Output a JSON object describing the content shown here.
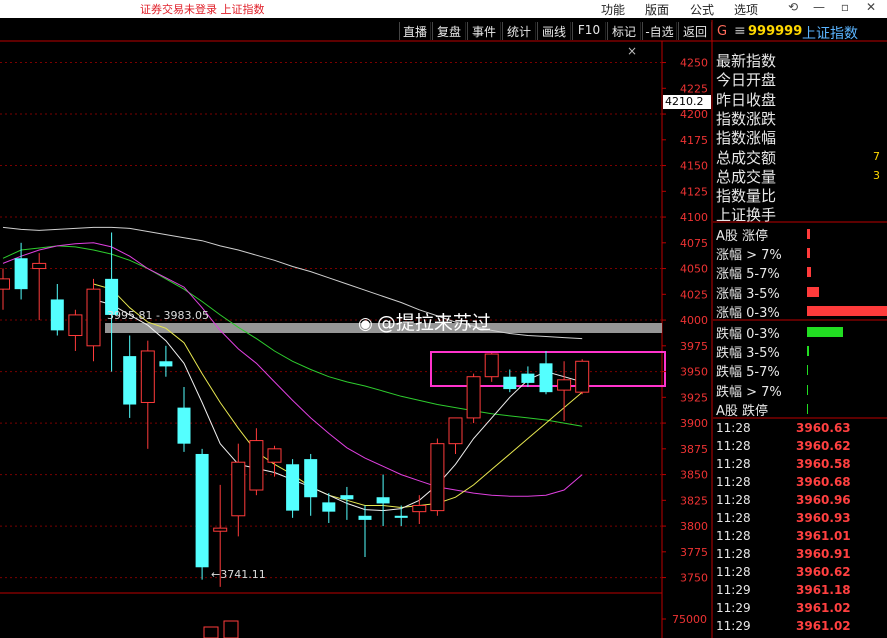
{
  "topbar": {
    "status": "证券交易未登录  上证指数",
    "menus": [
      "功能",
      "版面",
      "公式",
      "选项"
    ],
    "controls": [
      "⟲",
      "—",
      "▫",
      "✕"
    ]
  },
  "toolbar": {
    "buttons": [
      "直播",
      "复盘",
      "事件",
      "统计",
      "画线",
      "F10",
      "标记",
      "-自选",
      "返回"
    ],
    "close": "×"
  },
  "panel": {
    "g": "G",
    "menu_icon": "≡",
    "code": "999999",
    "name": "上证指数",
    "info_labels": [
      "最新指数",
      "今日开盘",
      "昨日收盘",
      "指数涨跌",
      "指数涨幅",
      "总成交额",
      "总成交量",
      "指数量比",
      "上证换手"
    ],
    "info_values": {
      "amount": "7",
      "volume": "3"
    },
    "dist_labels": [
      "A股 涨停",
      "涨幅 > 7%",
      "涨幅 5-7%",
      "涨幅 3-5%",
      "涨幅 0-3%",
      "跌幅 0-3%",
      "跌幅 3-5%",
      "跌幅 5-7%",
      "跌幅 > 7%",
      "A股 跌停"
    ],
    "ticks": [
      {
        "time": "11:28",
        "price": "3960.63"
      },
      {
        "time": "11:28",
        "price": "3960.62"
      },
      {
        "time": "11:28",
        "price": "3960.58"
      },
      {
        "time": "11:28",
        "price": "3960.68"
      },
      {
        "time": "11:28",
        "price": "3960.96"
      },
      {
        "time": "11:28",
        "price": "3960.93"
      },
      {
        "time": "11:28",
        "price": "3961.01"
      },
      {
        "time": "11:28",
        "price": "3960.91"
      },
      {
        "time": "11:28",
        "price": "3960.62"
      },
      {
        "time": "11:29",
        "price": "3961.18"
      },
      {
        "time": "11:29",
        "price": "3961.02"
      },
      {
        "time": "11:29",
        "price": "3961.02"
      }
    ]
  },
  "chart_data": {
    "type": "candlestick",
    "y_ticks": [
      4250,
      4225,
      4200,
      4175,
      4150,
      4125,
      4100,
      4075,
      4050,
      4025,
      4000,
      3975,
      3950,
      3925,
      3900,
      3875,
      3850,
      3825,
      3800,
      3775,
      3750
    ],
    "ylim": [
      3736,
      4268
    ],
    "current_price_label": "4210.2",
    "range_label": "3995.81 - 3983.05",
    "low_label": "←3741.11",
    "volume_tick": "75000",
    "grid": true,
    "candles": [
      {
        "o": 4030,
        "h": 4050,
        "l": 4010,
        "c": 4040
      },
      {
        "o": 4060,
        "h": 4075,
        "l": 4020,
        "c": 4030
      },
      {
        "o": 4050,
        "h": 4065,
        "l": 4000,
        "c": 4055
      },
      {
        "o": 4020,
        "h": 4035,
        "l": 3985,
        "c": 3990
      },
      {
        "o": 3985,
        "h": 4010,
        "l": 3970,
        "c": 4005
      },
      {
        "o": 3975,
        "h": 4040,
        "l": 3960,
        "c": 4030
      },
      {
        "o": 4040,
        "h": 4085,
        "l": 3950,
        "c": 4005
      },
      {
        "o": 3965,
        "h": 3985,
        "l": 3905,
        "c": 3918
      },
      {
        "o": 3920,
        "h": 3980,
        "l": 3875,
        "c": 3970
      },
      {
        "o": 3960,
        "h": 3975,
        "l": 3945,
        "c": 3955
      },
      {
        "o": 3915,
        "h": 3935,
        "l": 3872,
        "c": 3880
      },
      {
        "o": 3870,
        "h": 3875,
        "l": 3748,
        "c": 3760
      },
      {
        "o": 3795,
        "h": 3840,
        "l": 3741,
        "c": 3798
      },
      {
        "o": 3810,
        "h": 3880,
        "l": 3790,
        "c": 3862
      },
      {
        "o": 3835,
        "h": 3895,
        "l": 3830,
        "c": 3883
      },
      {
        "o": 3862,
        "h": 3878,
        "l": 3848,
        "c": 3875
      },
      {
        "o": 3860,
        "h": 3865,
        "l": 3808,
        "c": 3815
      },
      {
        "o": 3865,
        "h": 3870,
        "l": 3810,
        "c": 3828
      },
      {
        "o": 3823,
        "h": 3832,
        "l": 3803,
        "c": 3814
      },
      {
        "o": 3830,
        "h": 3838,
        "l": 3806,
        "c": 3826
      },
      {
        "o": 3810,
        "h": 3820,
        "l": 3770,
        "c": 3806
      },
      {
        "o": 3828,
        "h": 3850,
        "l": 3800,
        "c": 3822
      },
      {
        "o": 3810,
        "h": 3820,
        "l": 3800,
        "c": 3808
      },
      {
        "o": 3814,
        "h": 3830,
        "l": 3802,
        "c": 3820
      },
      {
        "o": 3815,
        "h": 3885,
        "l": 3810,
        "c": 3880
      },
      {
        "o": 3880,
        "h": 3905,
        "l": 3870,
        "c": 3905
      },
      {
        "o": 3905,
        "h": 3948,
        "l": 3900,
        "c": 3945
      },
      {
        "o": 3945,
        "h": 3968,
        "l": 3940,
        "c": 3967
      },
      {
        "o": 3945,
        "h": 3952,
        "l": 3930,
        "c": 3933
      },
      {
        "o": 3948,
        "h": 3955,
        "l": 3935,
        "c": 3939
      },
      {
        "o": 3958,
        "h": 3970,
        "l": 3928,
        "c": 3930
      },
      {
        "o": 3932,
        "h": 3960,
        "l": 3902,
        "c": 3942
      },
      {
        "o": 3930,
        "h": 3962,
        "l": 3928,
        "c": 3960
      }
    ],
    "ma_white": [
      4090,
      4088,
      4087,
      4088,
      4089,
      4090,
      4090,
      4089,
      4086,
      4083,
      4080,
      4077,
      4072,
      4068,
      4063,
      4058,
      4052,
      4047,
      4041,
      4035,
      4029,
      4023,
      4017,
      4010,
      4004,
      3998,
      3994,
      3990,
      3987,
      3985,
      3984,
      3983,
      3982
    ],
    "ma_magenta": [
      4055,
      4062,
      4068,
      4072,
      4074,
      4075,
      4071,
      4062,
      4050,
      4041,
      4032,
      4012,
      3990,
      3972,
      3958,
      3940,
      3922,
      3905,
      3890,
      3876,
      3866,
      3858,
      3850,
      3844,
      3838,
      3835,
      3832,
      3830,
      3829,
      3829,
      3830,
      3835,
      3850
    ],
    "ma_green": [
      4060,
      4068,
      4070,
      4072,
      4071,
      4068,
      4064,
      4058,
      4050,
      4040,
      4030,
      4018,
      4005,
      3993,
      3982,
      3970,
      3960,
      3952,
      3945,
      3940,
      3936,
      3931,
      3926,
      3922,
      3918,
      3915,
      3912,
      3909,
      3907,
      3905,
      3903,
      3900,
      3897
    ],
    "ma_yellow": [
      null,
      null,
      null,
      null,
      null,
      4035,
      4030,
      4012,
      3998,
      3992,
      3978,
      3948,
      3920,
      3895,
      3872,
      3860,
      3850,
      3838,
      3830,
      3825,
      3820,
      3820,
      3818,
      3820,
      3822,
      3828,
      3840,
      3855,
      3870,
      3885,
      3900,
      3915,
      3930
    ],
    "ma_white2": [
      null,
      null,
      null,
      null,
      null,
      4020,
      4015,
      4005,
      3995,
      3980,
      3958,
      3920,
      3880,
      3860,
      3856,
      3852,
      3845,
      3838,
      3830,
      3822,
      3816,
      3815,
      3817,
      3825,
      3840,
      3860,
      3885,
      3905,
      3925,
      3942,
      3950,
      3945,
      3940
    ]
  }
}
